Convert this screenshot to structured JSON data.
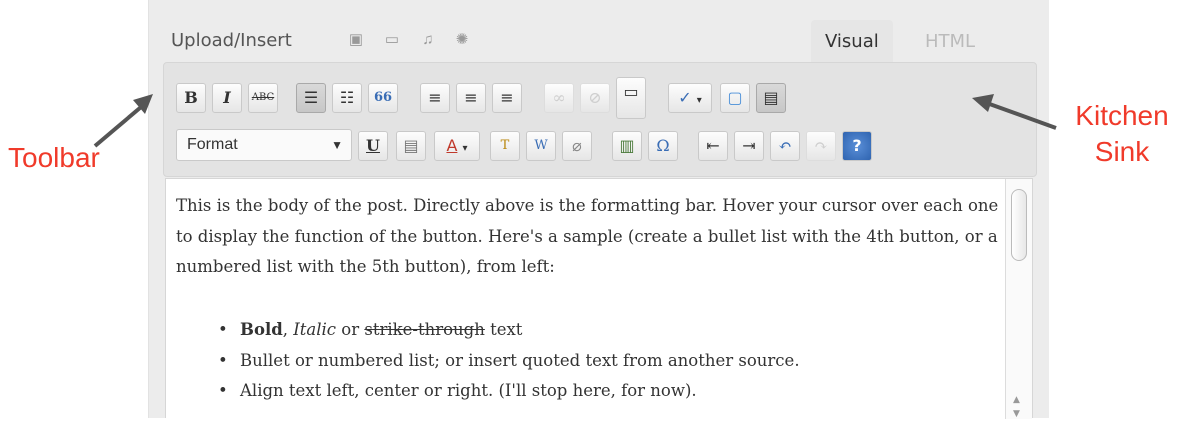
{
  "editor": {
    "upload_label": "Upload/Insert",
    "media_icons": [
      "image-icon",
      "video-icon",
      "audio-icon",
      "media-icon"
    ],
    "tabs": [
      {
        "label": "Visual",
        "active": true
      },
      {
        "label": "HTML",
        "active": false
      }
    ]
  },
  "toolbar": {
    "row1": [
      {
        "name": "bold-button",
        "glyph": "B"
      },
      {
        "name": "italic-button",
        "glyph": "I"
      },
      {
        "name": "strikethrough-button",
        "glyph": "ABC"
      },
      {
        "name": "bullet-list-button",
        "glyph": "☰"
      },
      {
        "name": "numbered-list-button",
        "glyph": "☷"
      },
      {
        "name": "blockquote-button",
        "glyph": "66"
      },
      {
        "name": "align-left-button",
        "glyph": "≡"
      },
      {
        "name": "align-center-button",
        "glyph": "≡"
      },
      {
        "name": "align-right-button",
        "glyph": "≡"
      },
      {
        "name": "link-button",
        "glyph": "∞"
      },
      {
        "name": "unlink-button",
        "glyph": "⊘"
      },
      {
        "name": "more-tag-button",
        "glyph": "▭"
      },
      {
        "name": "spellcheck-button",
        "glyph": "✓"
      },
      {
        "name": "fullscreen-button",
        "glyph": "▢"
      },
      {
        "name": "kitchen-sink-button",
        "glyph": "▤"
      }
    ],
    "format_select": "Format",
    "row2": [
      {
        "name": "underline-button",
        "glyph": "U"
      },
      {
        "name": "justify-button",
        "glyph": "▤"
      },
      {
        "name": "text-color-button",
        "glyph": "A"
      },
      {
        "name": "paste-text-button",
        "glyph": "T"
      },
      {
        "name": "paste-word-button",
        "glyph": "W"
      },
      {
        "name": "remove-format-button",
        "glyph": "⌀"
      },
      {
        "name": "insert-media-button",
        "glyph": "▥"
      },
      {
        "name": "special-character-button",
        "glyph": "Ω"
      },
      {
        "name": "outdent-button",
        "glyph": "⇤"
      },
      {
        "name": "indent-button",
        "glyph": "⇥"
      },
      {
        "name": "undo-button",
        "glyph": "↶"
      },
      {
        "name": "redo-button",
        "glyph": "↷"
      },
      {
        "name": "help-button",
        "glyph": "?"
      }
    ]
  },
  "content": {
    "paragraph": "This is the body of the post.  Directly above is the formatting bar.  Hover your cursor over each one to display the function of the button.  Here's a sample (create a bullet list with the 4th button, or a numbered list with the 5th button), from left:",
    "bullet1": {
      "bold": "Bold",
      "sep1": ", ",
      "italic": "Italic",
      "sep2": " or ",
      "strike": "strike-through",
      "rest": " text"
    },
    "bullet2": "Bullet or numbered list; or insert quoted text from another source.",
    "bullet3": "Align text left, center or right.  (I'll stop here, for now)."
  },
  "annotations": {
    "toolbar": "Toolbar",
    "kitchen_sink_line1": "Kitchen",
    "kitchen_sink_line2": "Sink",
    "color": "#f03a2a"
  }
}
